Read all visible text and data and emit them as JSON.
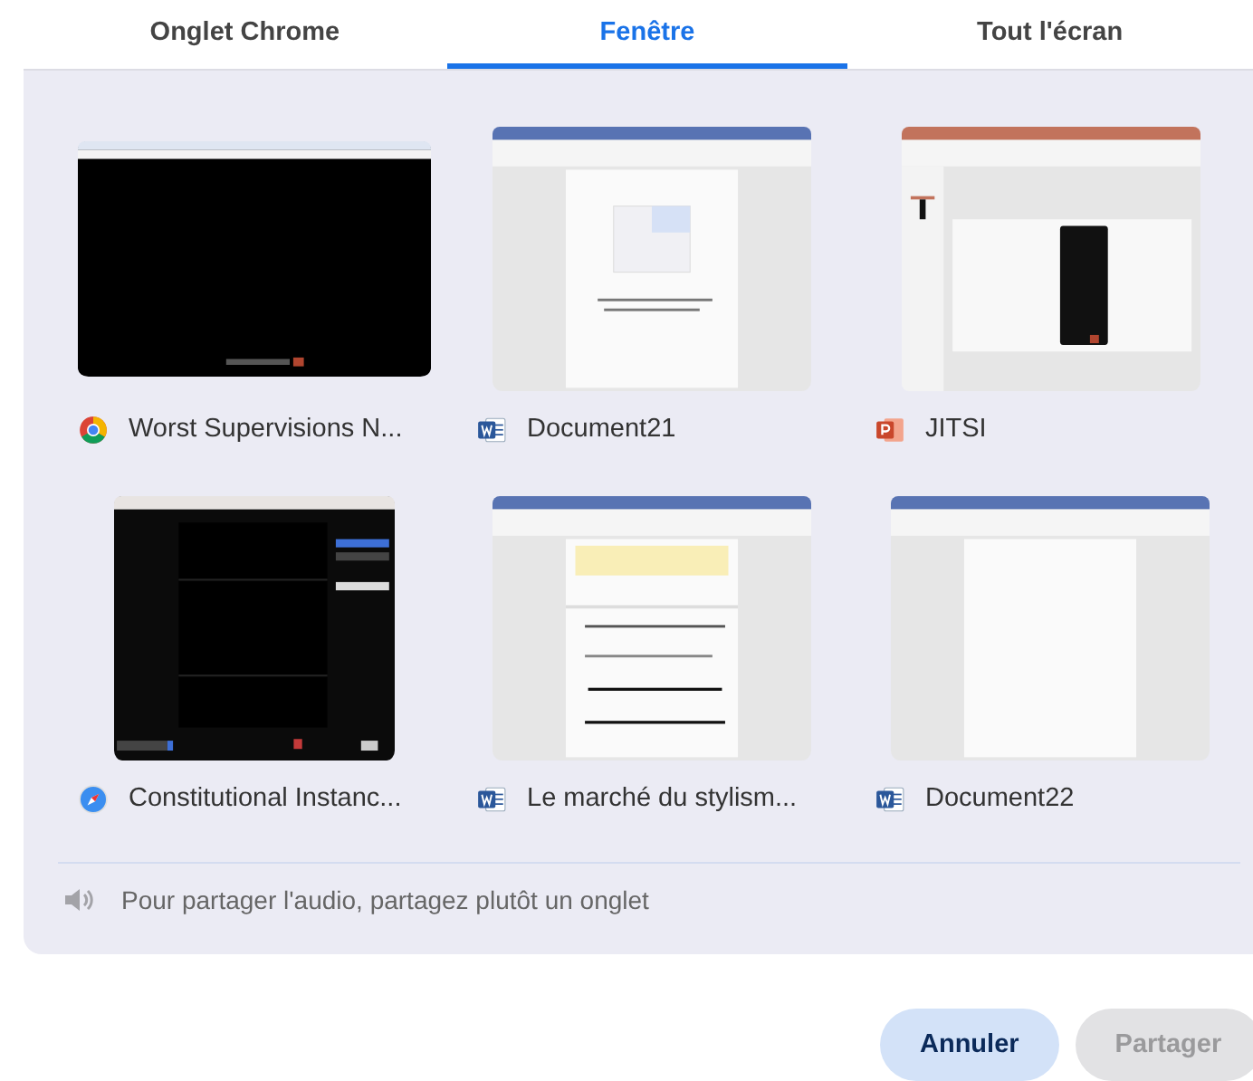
{
  "tabs": [
    {
      "label": "Onglet Chrome",
      "selected": false
    },
    {
      "label": "Fenêtre",
      "selected": true
    },
    {
      "label": "Tout l'écran",
      "selected": false
    }
  ],
  "windows": [
    {
      "title": "Worst Supervisions N...",
      "icon": {
        "kind": "chrome"
      },
      "preview": {
        "kind": "dark-browser"
      }
    },
    {
      "title": "Document21",
      "icon": {
        "kind": "word"
      },
      "preview": {
        "kind": "document"
      }
    },
    {
      "title": "JITSI",
      "icon": {
        "kind": "powerpoint"
      },
      "preview": {
        "kind": "slides"
      }
    },
    {
      "title": "Constitutional Instanc...",
      "icon": {
        "kind": "safari"
      },
      "preview": {
        "kind": "meeting"
      }
    },
    {
      "title": "Le marché du stylism...",
      "icon": {
        "kind": "word"
      },
      "preview": {
        "kind": "document-cover"
      }
    },
    {
      "title": "Document22",
      "icon": {
        "kind": "word"
      },
      "preview": {
        "kind": "blank-document"
      }
    }
  ],
  "audio_note": "Pour partager l'audio, partagez plutôt un onglet",
  "buttons": [
    {
      "label": "Annuler",
      "disabled": false
    },
    {
      "label": "Partager",
      "disabled": true
    }
  ]
}
